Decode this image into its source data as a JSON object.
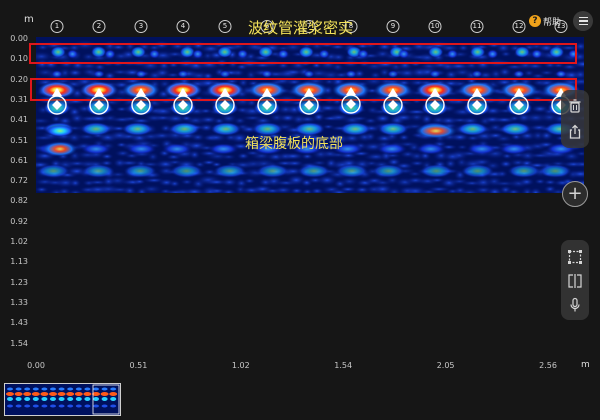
{
  "annotations": {
    "duct_grouting": "波纹管灌浆密实",
    "web_bottom": "箱梁腹板的底部"
  },
  "axes": {
    "depth_unit": "m",
    "depth_ticks": [
      "0.00",
      "0.10",
      "0.20",
      "0.31",
      "0.41",
      "0.51",
      "0.61",
      "0.72",
      "0.82",
      "0.92",
      "1.02",
      "1.13",
      "1.23",
      "1.33",
      "1.43",
      "1.54"
    ],
    "distance_unit": "m",
    "distance_ticks": [
      "0.00",
      "0.51",
      "1.02",
      "1.54",
      "2.05",
      "2.56"
    ]
  },
  "channels": [
    "1",
    "2",
    "3",
    "4",
    "5",
    "6",
    "7",
    "8",
    "9",
    "10",
    "11",
    "12",
    "13"
  ],
  "toolbar": {
    "help_label": "帮助",
    "help_icon": "question-icon",
    "menu_icon": "menu-icon",
    "tools": [
      "trash-icon",
      "share-icon",
      "add-icon",
      "select-box-icon",
      "split-view-icon",
      "microphone-icon"
    ]
  },
  "colors": {
    "annotation": "#f3e25a",
    "highlight_box": "#e0161b",
    "background": "#161616",
    "radar_base": "#000a5a"
  }
}
